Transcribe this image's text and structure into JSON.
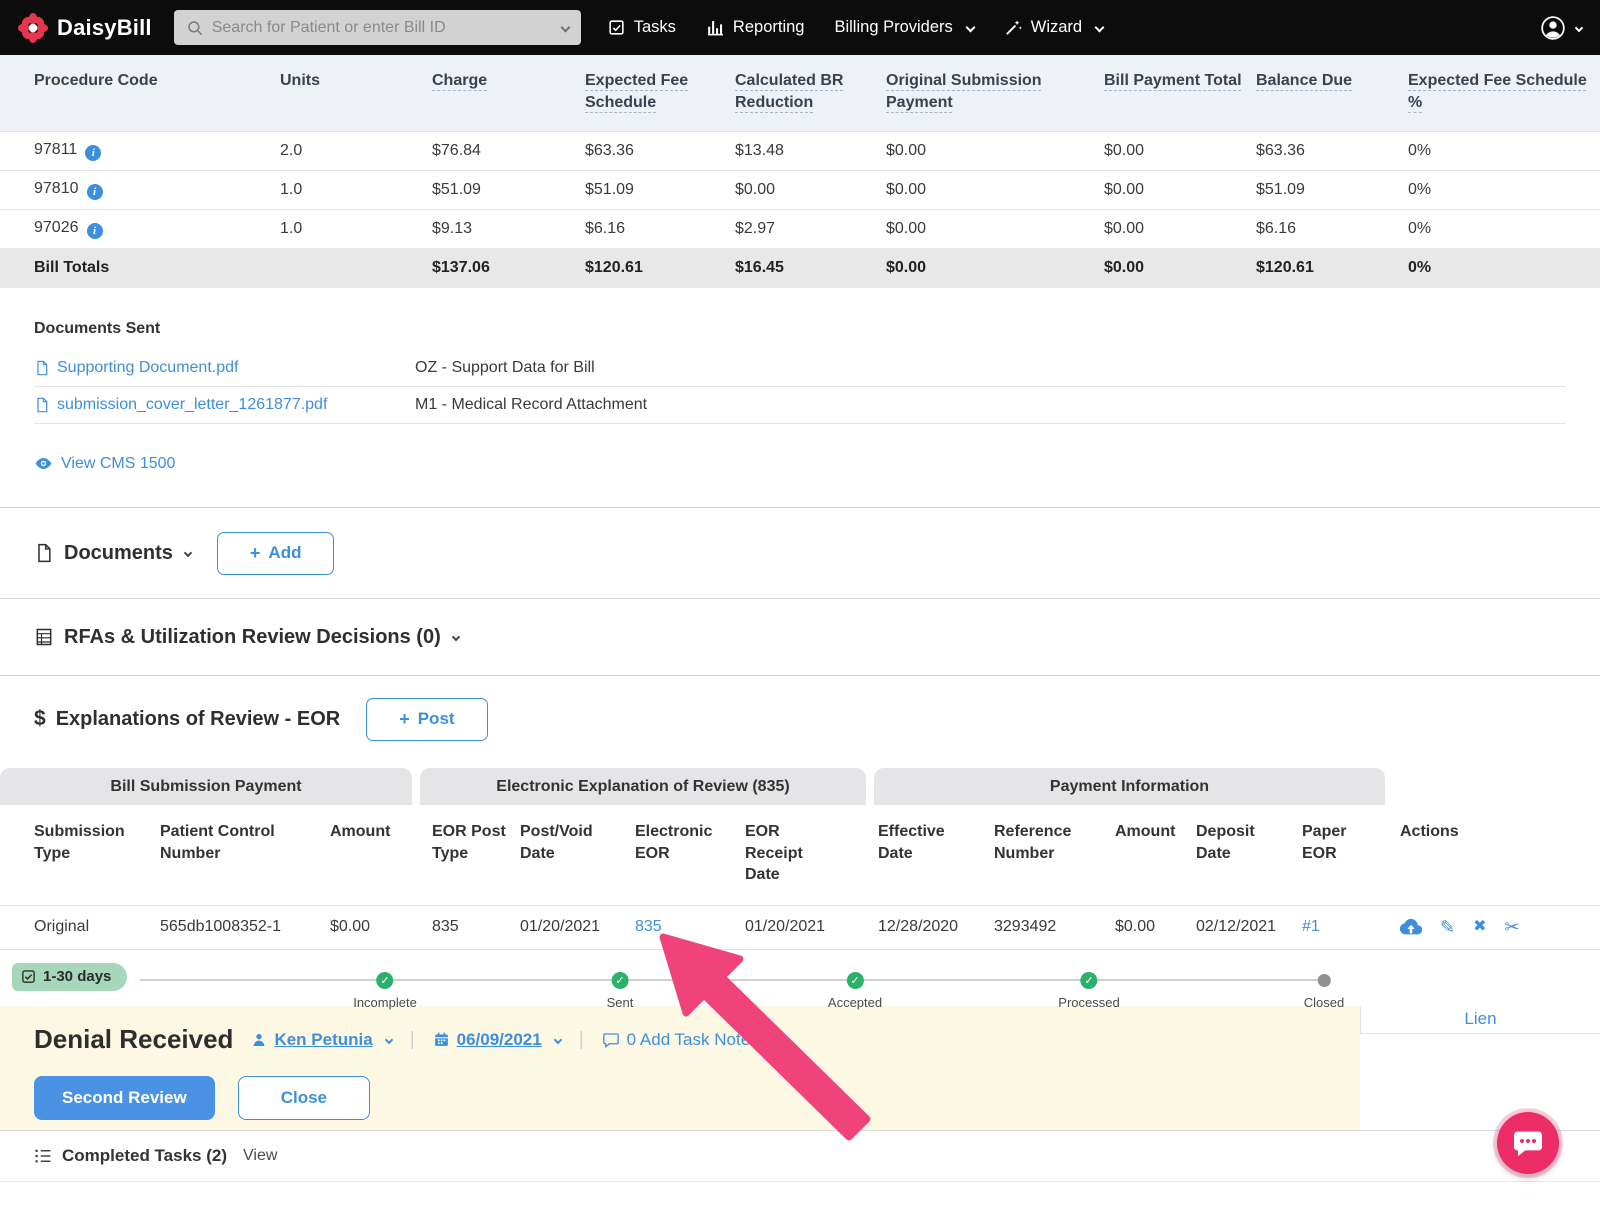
{
  "colors": {
    "accent_blue": "#3e8ede",
    "success_green": "#2bb169",
    "badge_green": "#a6d7ba",
    "panel_yellow": "#fdf8e3",
    "arrow_pink": "#f0437b",
    "chat_pink": "#ed2d67",
    "brand_red": "#e8364f"
  },
  "navbar": {
    "brand": "DaisyBill",
    "search_placeholder": "Search for Patient or enter Bill ID",
    "tasks_label": "Tasks",
    "reporting_label": "Reporting",
    "billing_providers_label": "Billing Providers",
    "wizard_label": "Wizard"
  },
  "procedure_table": {
    "headers": [
      "Procedure Code",
      "Units",
      "Charge",
      "Expected Fee Schedule",
      "Calculated BR Reduction",
      "Original Submission Payment",
      "Bill Payment Total",
      "Balance Due",
      "Expected Fee Schedule %"
    ],
    "rows": [
      [
        "97811",
        "2.0",
        "$76.84",
        "$63.36",
        "$13.48",
        "$0.00",
        "$0.00",
        "$63.36",
        "0%"
      ],
      [
        "97810",
        "1.0",
        "$51.09",
        "$51.09",
        "$0.00",
        "$0.00",
        "$0.00",
        "$51.09",
        "0%"
      ],
      [
        "97026",
        "1.0",
        "$9.13",
        "$6.16",
        "$2.97",
        "$0.00",
        "$0.00",
        "$6.16",
        "0%"
      ]
    ],
    "totals": [
      "Bill Totals",
      "",
      "$137.06",
      "$120.61",
      "$16.45",
      "$0.00",
      "$0.00",
      "$120.61",
      "0%"
    ]
  },
  "documents_sent": {
    "title": "Documents Sent",
    "files": [
      {
        "name": "Supporting Document.pdf",
        "description": "OZ - Support Data for Bill"
      },
      {
        "name": "submission_cover_letter_1261877.pdf",
        "description": "M1 - Medical Record Attachment"
      }
    ],
    "view_cms_label": "View CMS 1500"
  },
  "documents_bar": {
    "title": "Documents",
    "add_label": "Add"
  },
  "rfa_bar": {
    "title": "RFAs & Utilization Review Decisions (0)"
  },
  "eor_bar": {
    "dollar": "$",
    "title": "Explanations of Review - EOR",
    "post_label": "Post"
  },
  "eor_table": {
    "groups": [
      "Bill Submission Payment",
      "Electronic Explanation of Review (835)",
      "Payment Information"
    ],
    "actions_header": "Actions",
    "columns": [
      "Submission Type",
      "Patient Control Number",
      "Amount",
      "EOR Post Type",
      "Post/Void Date",
      "Electronic EOR",
      "EOR Receipt Date",
      "Effective Date",
      "Reference Number",
      "Amount",
      "Deposit Date",
      "Paper EOR"
    ],
    "row": [
      "Original",
      "565db1008352-1",
      "$0.00",
      "835",
      "01/20/2021",
      "835",
      "01/20/2021",
      "12/28/2020",
      "3293492",
      "$0.00",
      "02/12/2021",
      "#1"
    ]
  },
  "timeline": {
    "badge_label": "1-30 days",
    "stages": [
      {
        "label": "Incomplete",
        "done": true
      },
      {
        "label": "Sent",
        "done": true
      },
      {
        "label": "Accepted",
        "done": true
      },
      {
        "label": "Processed",
        "done": true
      },
      {
        "label": "Closed",
        "done": false
      }
    ]
  },
  "status_panel": {
    "title": "Denial Received",
    "assignee": "Ken Petunia",
    "date": "06/09/2021",
    "task_note_label": "0 Add Task Note",
    "second_review_label": "Second Review",
    "close_label": "Close"
  },
  "lien": {
    "label": "Lien"
  },
  "completed_tasks": {
    "label": "Completed Tasks (2)",
    "view_label": "View"
  }
}
